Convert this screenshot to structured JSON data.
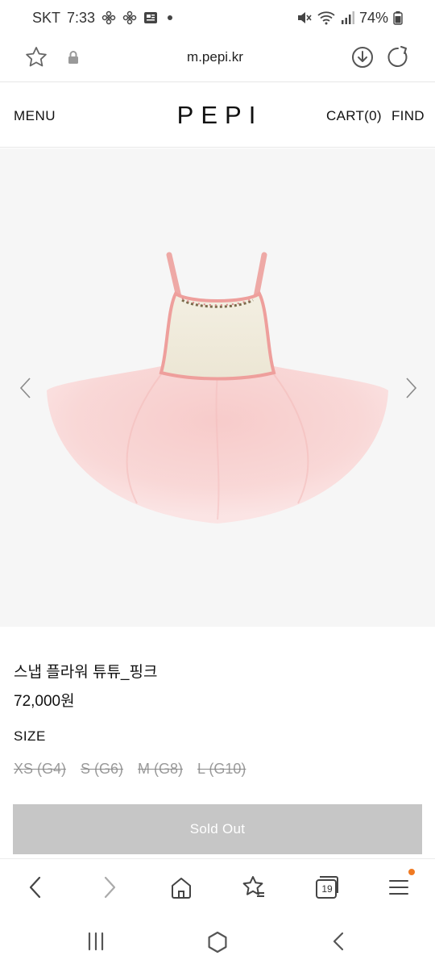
{
  "status_bar": {
    "carrier": "SKT",
    "time": "7:33",
    "battery": "74%",
    "icons": [
      "flower-icon",
      "flower-icon",
      "news-icon",
      "dot-icon",
      "mute-icon",
      "wifi-icon",
      "signal-icon",
      "battery-icon"
    ]
  },
  "browser": {
    "url": "m.pepi.kr",
    "tab_count": "19",
    "icons": [
      "star-icon",
      "lock-icon",
      "download-icon",
      "reload-icon"
    ]
  },
  "header": {
    "menu": "MENU",
    "logo": "PEPI",
    "cart": "CART(0)",
    "find": "FIND"
  },
  "product": {
    "name": "스냅 플라워 튜튜_핑크",
    "price": "72,000원",
    "size_label": "SIZE",
    "sizes": [
      "XS (G4)",
      "S (G6)",
      "M (G8)",
      "L (G10)"
    ],
    "sold_out_label": "Sold Out"
  },
  "colors": {
    "accent_dot": "#f07a22",
    "sold_out_bg": "#c6c6c6",
    "gallery_bg": "#f6f6f6",
    "disabled_text": "#9a9a9a"
  }
}
